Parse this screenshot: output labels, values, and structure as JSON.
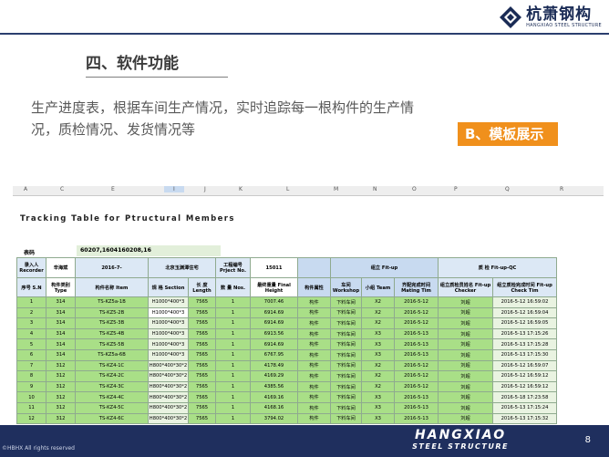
{
  "brand": {
    "cn": "杭萧钢构",
    "en": "HANGXIAO STEEL STRUCTURE"
  },
  "section_title": "四、软件功能",
  "description": "生产进度表，根据车间生产情况，实时追踪每一根构件的生产情况，质检情况、发货情况等",
  "badge": "B、模板展示",
  "sheet": {
    "col_letters": [
      "A",
      "C",
      "E",
      "I",
      "J",
      "K",
      "L",
      "M",
      "N",
      "O",
      "P",
      "Q",
      "R"
    ],
    "title": "Tracking Table for Ptructural Members",
    "code_label": "表码",
    "code_value": "60207,1604160208,16",
    "header1": {
      "recorder": "录入人 Recorder",
      "recorder_name": "辛海斌",
      "date": "2016-7-",
      "project_name": "北京玉渊潭住宅",
      "project_no_label": "工程编号 Prject No.",
      "project_no": "15011",
      "fitup_group": "组立 Fit-up",
      "qc_group": "质 检 Fit-up-QC"
    },
    "header2": [
      "序号 S.N",
      "构件类别 Type",
      "构件名称 Item",
      "规 格 Section",
      "长 度 Length",
      "数 量 Nos.",
      "最终重量 Final Height",
      "构件属性",
      "车间 Workshop",
      "小组 Team",
      "齐配完成时间 Mating Tim",
      "组立质检员姓名 Fit-up Checker",
      "组立质检完成时间 Fit-up Check Tim"
    ],
    "rows": [
      [
        "1",
        "314",
        "TS-KZ5a-1B",
        "H1000*400*3",
        "7565",
        "1",
        "7007.46",
        "构件",
        "下料车间",
        "X2",
        "2016-5-12",
        "刘超",
        "2016-5-12 16:59:02"
      ],
      [
        "2",
        "314",
        "TS-KZ5-2B",
        "H1000*400*3",
        "7565",
        "1",
        "6914.69",
        "构件",
        "下料车间",
        "X2",
        "2016-5-12",
        "刘超",
        "2016-5-12 16:59:04"
      ],
      [
        "3",
        "314",
        "TS-KZ5-3B",
        "H1000*400*3",
        "7565",
        "1",
        "6914.69",
        "构件",
        "下料车间",
        "X2",
        "2016-5-12",
        "刘超",
        "2016-5-12 16:59:05"
      ],
      [
        "4",
        "314",
        "TS-KZ5-4B",
        "H1000*400*3",
        "7565",
        "1",
        "6913.56",
        "构件",
        "下料车间",
        "X3",
        "2016-5-13",
        "刘超",
        "2016-5-13 17:15:26"
      ],
      [
        "5",
        "314",
        "TS-KZ5-5B",
        "H1000*400*3",
        "7565",
        "1",
        "6914.69",
        "构件",
        "下料车间",
        "X3",
        "2016-5-13",
        "刘超",
        "2016-5-13 17:15:28"
      ],
      [
        "6",
        "314",
        "TS-KZ5a-6B",
        "H1000*400*3",
        "7565",
        "1",
        "6767.95",
        "构件",
        "下料车间",
        "X3",
        "2016-5-13",
        "刘超",
        "2016-5-13 17:15:30"
      ],
      [
        "7",
        "312",
        "TS-KZ4-1C",
        "H800*400*30*2",
        "7565",
        "1",
        "4178.49",
        "构件",
        "下料车间",
        "X2",
        "2016-5-12",
        "刘超",
        "2016-5-12 16:59:07"
      ],
      [
        "8",
        "312",
        "TS-KZ4-2C",
        "H800*400*30*2",
        "7565",
        "1",
        "4169.29",
        "构件",
        "下料车间",
        "X2",
        "2016-5-12",
        "刘超",
        "2016-5-12 16:59:12"
      ],
      [
        "9",
        "312",
        "TS-KZ4-3C",
        "H800*400*30*2",
        "7565",
        "1",
        "4385.56",
        "构件",
        "下料车间",
        "X2",
        "2016-5-12",
        "刘超",
        "2016-5-12 16:59:12"
      ],
      [
        "10",
        "312",
        "TS-KZ4-4C",
        "H800*400*30*2",
        "7565",
        "1",
        "4169.16",
        "构件",
        "下料车间",
        "X3",
        "2016-5-13",
        "刘超",
        "2016-5-18 17:23:58"
      ],
      [
        "11",
        "312",
        "TS-KZ4-5C",
        "H800*400*30*2",
        "7565",
        "1",
        "4168.16",
        "构件",
        "下料车间",
        "X3",
        "2016-5-13",
        "刘超",
        "2016-5-13 17:15:24"
      ],
      [
        "12",
        "312",
        "TS-KZ4-6C",
        "H800*400*30*2",
        "7565",
        "1",
        "3794.02",
        "构件",
        "下料车间",
        "X3",
        "2016-5-13",
        "刘超",
        "2016-5-13 17:15:32"
      ]
    ]
  },
  "footer": {
    "copyright": "©HBHX All rights reserved",
    "brand_cn": "HANGXIAO",
    "brand_en": "STEEL STRUCTURE",
    "page": "8"
  }
}
